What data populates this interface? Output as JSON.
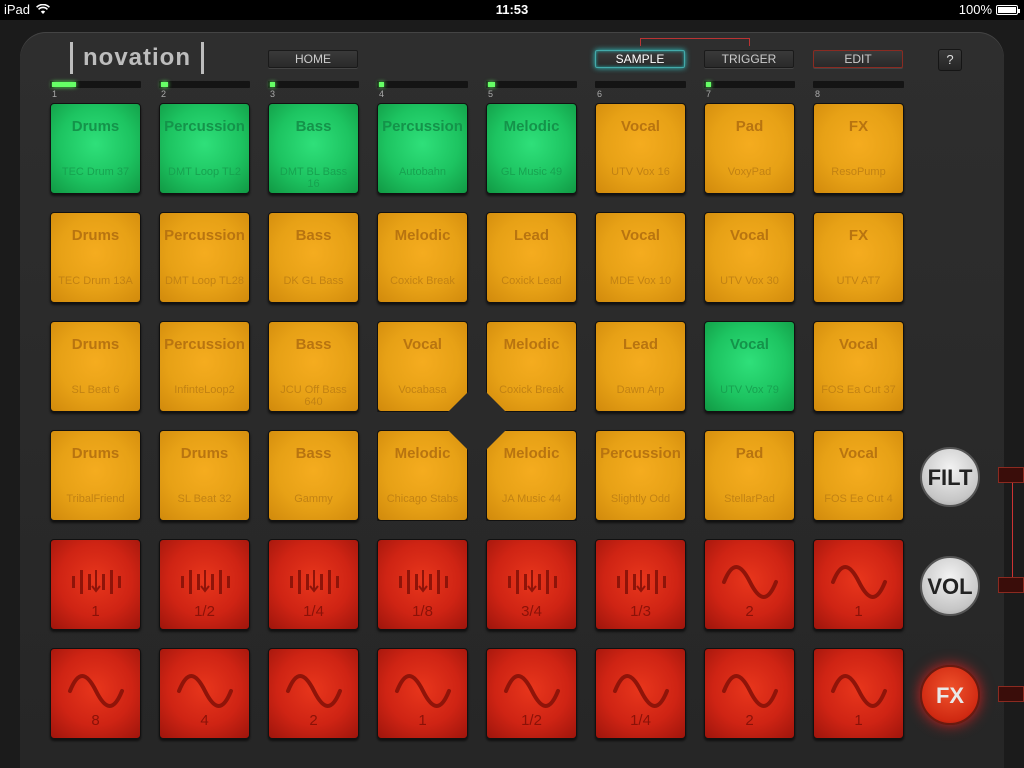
{
  "status": {
    "device": "iPad",
    "time": "11:53",
    "battery": "100%"
  },
  "header": {
    "logo": "novation",
    "buttons": {
      "home": "HOME",
      "sample": "SAMPLE",
      "trigger": "TRIGGER",
      "edit": "EDIT",
      "help": "?"
    }
  },
  "tracks": [
    {
      "num": "1",
      "level": 0.28
    },
    {
      "num": "2",
      "level": 0.08
    },
    {
      "num": "3",
      "level": 0.06
    },
    {
      "num": "4",
      "level": 0.06
    },
    {
      "num": "5",
      "level": 0.08
    },
    {
      "num": "6",
      "level": 0
    },
    {
      "num": "7",
      "level": 0.06
    },
    {
      "num": "8",
      "level": 0
    }
  ],
  "rows": [
    [
      {
        "title": "Drums",
        "sub": "TEC Drum 37",
        "color": "green"
      },
      {
        "title": "Percussion",
        "sub": "DMT Loop TL2",
        "color": "green"
      },
      {
        "title": "Bass",
        "sub": "DMT BL Bass 16",
        "color": "green"
      },
      {
        "title": "Percussion",
        "sub": "Autobahn",
        "color": "green"
      },
      {
        "title": "Melodic",
        "sub": "GL Music 49",
        "color": "green"
      },
      {
        "title": "Vocal",
        "sub": "UTV Vox 16",
        "color": "orange"
      },
      {
        "title": "Pad",
        "sub": "VoxyPad",
        "color": "orange"
      },
      {
        "title": "FX",
        "sub": "ResoPump",
        "color": "orange"
      }
    ],
    [
      {
        "title": "Drums",
        "sub": "TEC Drum 13A",
        "color": "orange"
      },
      {
        "title": "Percussion",
        "sub": "DMT Loop TL28",
        "color": "orange"
      },
      {
        "title": "Bass",
        "sub": "DK GL Bass",
        "color": "orange"
      },
      {
        "title": "Melodic",
        "sub": "Coxick Break",
        "color": "orange"
      },
      {
        "title": "Lead",
        "sub": "Coxick Lead",
        "color": "orange"
      },
      {
        "title": "Vocal",
        "sub": "MDE Vox 10",
        "color": "orange"
      },
      {
        "title": "Vocal",
        "sub": "UTV Vox 30",
        "color": "orange"
      },
      {
        "title": "FX",
        "sub": "UTV AT7",
        "color": "orange"
      }
    ],
    [
      {
        "title": "Drums",
        "sub": "SL Beat 6",
        "color": "orange"
      },
      {
        "title": "Percussion",
        "sub": "InfinteLoop2",
        "color": "orange"
      },
      {
        "title": "Bass",
        "sub": "JCU Off Bass 640",
        "color": "orange"
      },
      {
        "title": "Vocal",
        "sub": "Vocabasa",
        "color": "orange",
        "cut": "br"
      },
      {
        "title": "Melodic",
        "sub": "Coxick Break",
        "color": "orange",
        "cut": "bl"
      },
      {
        "title": "Lead",
        "sub": "Dawn Arp",
        "color": "orange"
      },
      {
        "title": "Vocal",
        "sub": "UTV Vox 79",
        "color": "green"
      },
      {
        "title": "Vocal",
        "sub": "FOS Ea Cut 37",
        "color": "orange"
      }
    ],
    [
      {
        "title": "Drums",
        "sub": "TribalFriend",
        "color": "orange"
      },
      {
        "title": "Drums",
        "sub": "SL Beat 32",
        "color": "orange"
      },
      {
        "title": "Bass",
        "sub": "Gammy",
        "color": "orange"
      },
      {
        "title": "Melodic",
        "sub": "Chicago Stabs",
        "color": "orange",
        "cut": "tr"
      },
      {
        "title": "Melodic",
        "sub": "JA Music 44",
        "color": "orange",
        "cut": "tl"
      },
      {
        "title": "Percussion",
        "sub": "Slightly Odd",
        "color": "orange"
      },
      {
        "title": "Pad",
        "sub": "StellarPad",
        "color": "orange"
      },
      {
        "title": "Vocal",
        "sub": "FOS Ee Cut 4",
        "color": "orange"
      }
    ],
    [
      {
        "sub": "1",
        "color": "red",
        "icon": "slicer"
      },
      {
        "sub": "1/2",
        "color": "red",
        "icon": "slicer"
      },
      {
        "sub": "1/4",
        "color": "red",
        "icon": "slicer"
      },
      {
        "sub": "1/8",
        "color": "red",
        "icon": "slicer"
      },
      {
        "sub": "3/4",
        "color": "red",
        "icon": "slicer"
      },
      {
        "sub": "1/3",
        "color": "red",
        "icon": "slicer"
      },
      {
        "sub": "2",
        "color": "red",
        "icon": "wave"
      },
      {
        "sub": "1",
        "color": "red",
        "icon": "wave"
      }
    ],
    [
      {
        "sub": "8",
        "color": "red",
        "icon": "wave"
      },
      {
        "sub": "4",
        "color": "red",
        "icon": "wave"
      },
      {
        "sub": "2",
        "color": "red",
        "icon": "wave"
      },
      {
        "sub": "1",
        "color": "red",
        "icon": "wave"
      },
      {
        "sub": "1/2",
        "color": "red",
        "icon": "wave"
      },
      {
        "sub": "1/4",
        "color": "red",
        "icon": "wave"
      },
      {
        "sub": "2",
        "color": "red",
        "icon": "wave"
      },
      {
        "sub": "1",
        "color": "red",
        "icon": "wave"
      }
    ]
  ],
  "side": {
    "filt": "FILT",
    "vol": "VOL",
    "fx": "FX"
  }
}
